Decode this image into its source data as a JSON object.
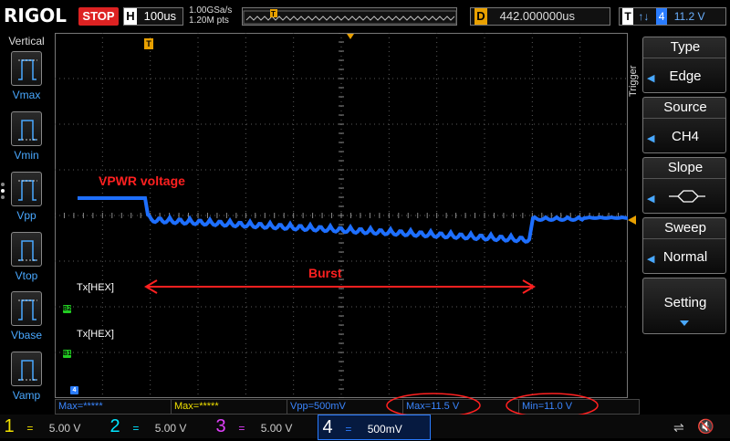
{
  "header": {
    "logo": "RIGOL",
    "run_state": "STOP",
    "horizontal_key": "H",
    "timebase": "100us",
    "sample_rate": "1.00GSa/s",
    "memory_depth": "1.20M pts",
    "delay_key": "D",
    "delay_value": "442.000000us",
    "trigger_key": "T",
    "trigger_slope_symbol": "↑↓",
    "trigger_channel": "4",
    "trigger_level": "11.2 V"
  },
  "left_panel": {
    "title": "Vertical",
    "items": [
      {
        "label": "Vmax",
        "icon": "vmax-waveform-icon"
      },
      {
        "label": "Vmin",
        "icon": "vmin-waveform-icon"
      },
      {
        "label": "Vpp",
        "icon": "vpp-waveform-icon"
      },
      {
        "label": "Vtop",
        "icon": "vtop-waveform-icon"
      },
      {
        "label": "Vbase",
        "icon": "vbase-waveform-icon"
      },
      {
        "label": "Vamp",
        "icon": "vamp-waveform-icon"
      }
    ]
  },
  "right_panel": {
    "title": "Trigger",
    "type_label": "Type",
    "type_value": "Edge",
    "source_label": "Source",
    "source_value": "CH4",
    "slope_label": "Slope",
    "sweep_label": "Sweep",
    "sweep_value": "Normal",
    "setting_label": "Setting"
  },
  "screen": {
    "trigger_marker": "T",
    "decoder_labels": [
      "Tx[HEX]",
      "Tx[HEX]"
    ],
    "bus_markers": [
      "B2",
      "B1"
    ],
    "annotation_signal": "VPWR voltage",
    "annotation_burst": "Burst"
  },
  "measurements": [
    {
      "text": "Max=*****",
      "color": "#3a86ff"
    },
    {
      "text": "Max=*****",
      "color": "#f0e000"
    },
    {
      "text": "Vpp=500mV",
      "color": "#3a86ff"
    },
    {
      "text": "Max=11.5 V",
      "color": "#3a86ff"
    },
    {
      "text": "Min=11.0 V",
      "color": "#3a86ff"
    }
  ],
  "channels": [
    {
      "num": "1",
      "scale": "5.00 V",
      "color": "#f0e000",
      "active": false
    },
    {
      "num": "2",
      "scale": "5.00 V",
      "color": "#00e5ff",
      "active": false
    },
    {
      "num": "3",
      "scale": "5.00 V",
      "color": "#e040fb",
      "active": false
    },
    {
      "num": "4",
      "scale": "500mV",
      "color": "#2a7cff",
      "active": true
    }
  ],
  "colors": {
    "trace": "#1e6fff",
    "annotation": "#ff2020",
    "grid": "#5a5a5a",
    "trigger": "#e8a000",
    "bus": "#22cc22"
  }
}
